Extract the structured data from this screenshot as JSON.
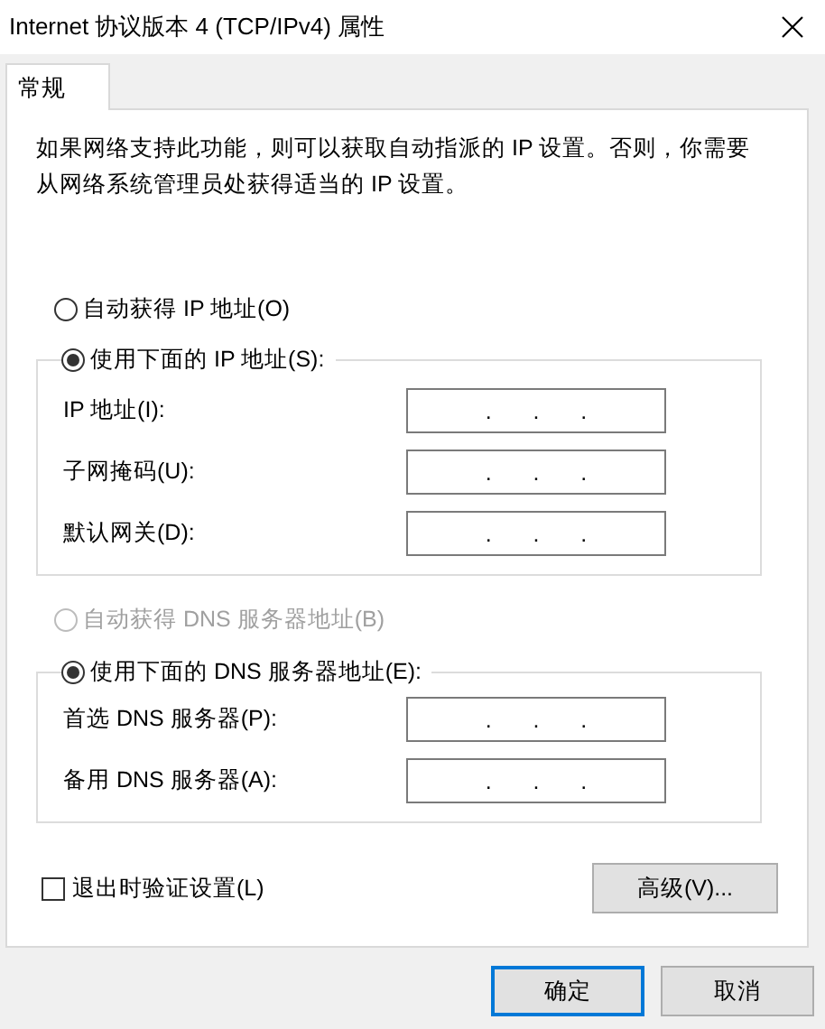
{
  "window": {
    "title": "Internet 协议版本 4 (TCP/IPv4) 属性"
  },
  "tabs": [
    {
      "label": "常规",
      "selected": true
    }
  ],
  "description": "如果网络支持此功能，则可以获取自动指派的 IP 设置。否则，你需要从网络系统管理员处获得适当的 IP 设置。",
  "ip_options": [
    {
      "label": "自动获得 IP 地址(O)",
      "selected": false,
      "disabled": false
    },
    {
      "label": "使用下面的 IP 地址(S):",
      "selected": true,
      "disabled": false
    }
  ],
  "ip_fields": [
    {
      "label": "IP 地址(I):",
      "separators": [
        ".",
        ".",
        "."
      ]
    },
    {
      "label": "子网掩码(U):",
      "separators": [
        ".",
        ".",
        "."
      ]
    },
    {
      "label": "默认网关(D):",
      "separators": [
        ".",
        ".",
        "."
      ]
    }
  ],
  "dns_options": [
    {
      "label": "自动获得 DNS 服务器地址(B)",
      "selected": false,
      "disabled": true
    },
    {
      "label": "使用下面的 DNS 服务器地址(E):",
      "selected": true,
      "disabled": false
    }
  ],
  "dns_fields": [
    {
      "label": "首选 DNS 服务器(P):",
      "separators": [
        ".",
        ".",
        "."
      ]
    },
    {
      "label": "备用 DNS 服务器(A):",
      "separators": [
        ".",
        ".",
        "."
      ]
    }
  ],
  "validate_checkbox": {
    "label": "退出时验证设置(L)",
    "checked": false
  },
  "advanced_button": "高级(V)...",
  "buttons": [
    {
      "label": "确定",
      "default": true
    },
    {
      "label": "取消",
      "default": false
    }
  ]
}
